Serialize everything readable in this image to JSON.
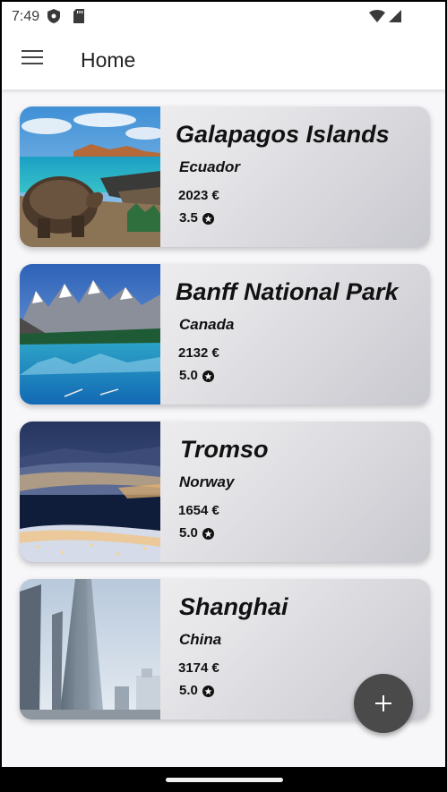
{
  "status_bar": {
    "time": "7:49",
    "icons": [
      "shield-icon",
      "sd-card-icon",
      "wifi-icon",
      "signal-icon"
    ]
  },
  "app_bar": {
    "menu_icon": "menu-icon",
    "title": "Home"
  },
  "destinations": [
    {
      "title": "Galapagos Islands",
      "country": "Ecuador",
      "price": "2023 €",
      "rating": "3.5",
      "image": "galapagos-tortoise-photo"
    },
    {
      "title": "Banff National Park",
      "country": "Canada",
      "price": "2132 €",
      "rating": "5.0",
      "image": "banff-lake-photo"
    },
    {
      "title": "Tromso",
      "country": "Norway",
      "price": "1654 €",
      "rating": "5.0",
      "image": "tromso-night-photo"
    },
    {
      "title": "Shanghai",
      "country": "China",
      "price": "3174 €",
      "rating": "5.0",
      "image": "shanghai-tower-photo"
    }
  ],
  "fab": {
    "icon": "plus-icon"
  },
  "colors": {
    "app_bar_bg": "#ffffff",
    "screen_bg": "#f7f6f8",
    "fab_bg": "#4a4a4a",
    "text": "#111111"
  }
}
